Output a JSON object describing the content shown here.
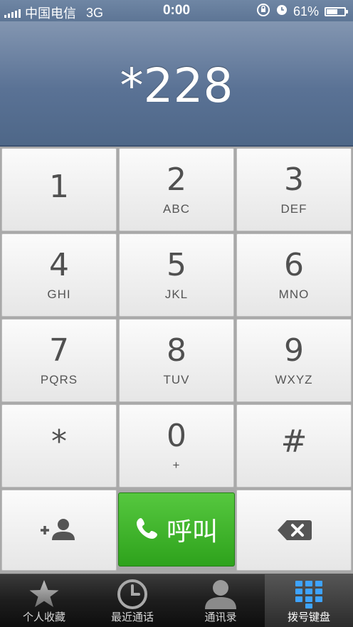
{
  "status_bar": {
    "carrier": "中国电信",
    "network": "3G",
    "time": "0:00",
    "battery": "61%",
    "battery_level": 0.61
  },
  "display": {
    "number": "*228"
  },
  "keys": [
    {
      "digit": "1",
      "letters": ""
    },
    {
      "digit": "2",
      "letters": "ABC"
    },
    {
      "digit": "3",
      "letters": "DEF"
    },
    {
      "digit": "4",
      "letters": "GHI"
    },
    {
      "digit": "5",
      "letters": "JKL"
    },
    {
      "digit": "6",
      "letters": "MNO"
    },
    {
      "digit": "7",
      "letters": "PQRS"
    },
    {
      "digit": "8",
      "letters": "TUV"
    },
    {
      "digit": "9",
      "letters": "WXYZ"
    },
    {
      "digit": "*",
      "letters": ""
    },
    {
      "digit": "0",
      "letters": "+"
    },
    {
      "digit": "#",
      "letters": ""
    }
  ],
  "call_button": {
    "label": "呼叫",
    "color": "#36a824"
  },
  "tabs": [
    {
      "label": "个人收藏",
      "icon": "star-icon"
    },
    {
      "label": "最近通话",
      "icon": "clock-icon"
    },
    {
      "label": "通讯录",
      "icon": "contacts-icon"
    },
    {
      "label": "拨号键盘",
      "icon": "keypad-icon",
      "active": true
    }
  ]
}
